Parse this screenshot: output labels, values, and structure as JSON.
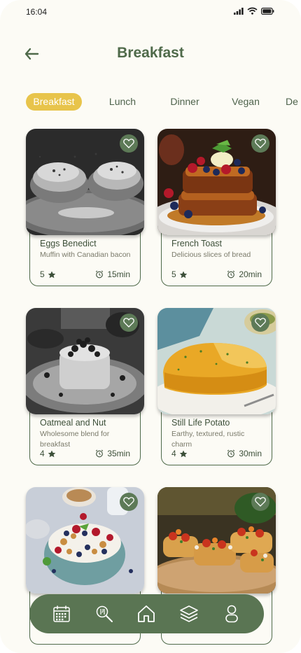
{
  "status": {
    "time": "16:04"
  },
  "header": {
    "title": "Breakfast"
  },
  "tabs": [
    {
      "label": "Breakfast",
      "active": true
    },
    {
      "label": "Lunch",
      "active": false
    },
    {
      "label": "Dinner",
      "active": false
    },
    {
      "label": "Vegan",
      "active": false
    },
    {
      "label": "De",
      "active": false
    }
  ],
  "recipes": [
    {
      "title": "Eggs Benedict",
      "description": "Muffin with Canadian bacon",
      "rating": "5",
      "time": "15min"
    },
    {
      "title": "French Toast",
      "description": "Delicious slices of bread",
      "rating": "5",
      "time": "20min"
    },
    {
      "title": "Oatmeal and Nut",
      "description": "Wholesome blend for breakfast",
      "rating": "4",
      "time": "35min"
    },
    {
      "title": "Still Life Potato",
      "description": "Earthy, textured, rustic charm",
      "rating": "4",
      "time": "30min"
    },
    {
      "title": "",
      "description": "",
      "rating": "",
      "time": ""
    },
    {
      "title": "",
      "description": "",
      "rating": "",
      "time": ""
    }
  ],
  "nav": [
    "calendar-icon",
    "search-food-icon",
    "home-icon",
    "layers-icon",
    "profile-icon"
  ],
  "colors": {
    "accent": "#e8c44b",
    "primary": "#5a7553",
    "background": "#fcfbf5"
  }
}
